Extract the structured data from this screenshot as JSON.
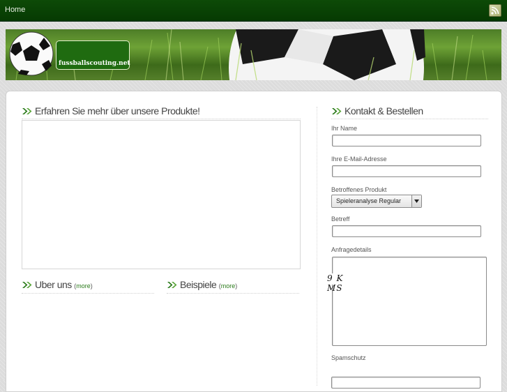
{
  "nav": {
    "home_label": "Home"
  },
  "icons": {
    "rss": "rss-feed-icon",
    "arrow": "double-chevron-icon"
  },
  "colors": {
    "topbar": "#063a02",
    "accent_green": "#2a7a1a",
    "heading_text": "#444444"
  },
  "banner": {
    "logo_text": "fussballscouting.net"
  },
  "products": {
    "title": "Erfahren Sie mehr über unsere Produkte!"
  },
  "about": {
    "title": "Uber uns",
    "more_label": "more"
  },
  "examples": {
    "title": "Beispiele",
    "more_label": "more"
  },
  "contact": {
    "title": "Kontakt & Bestellen",
    "name_label": "Ihr Name",
    "name_value": "",
    "email_label": "Ihre E-Mail-Adresse",
    "email_value": "",
    "product_label": "Betroffenes Produkt",
    "product_selected": "Spieleranalyse Regular",
    "subject_label": "Betreff",
    "subject_value": "",
    "details_label": "Anfragedetails",
    "details_value": "",
    "spam_label": "Spamschutz",
    "captcha_text": "9 K MS"
  }
}
